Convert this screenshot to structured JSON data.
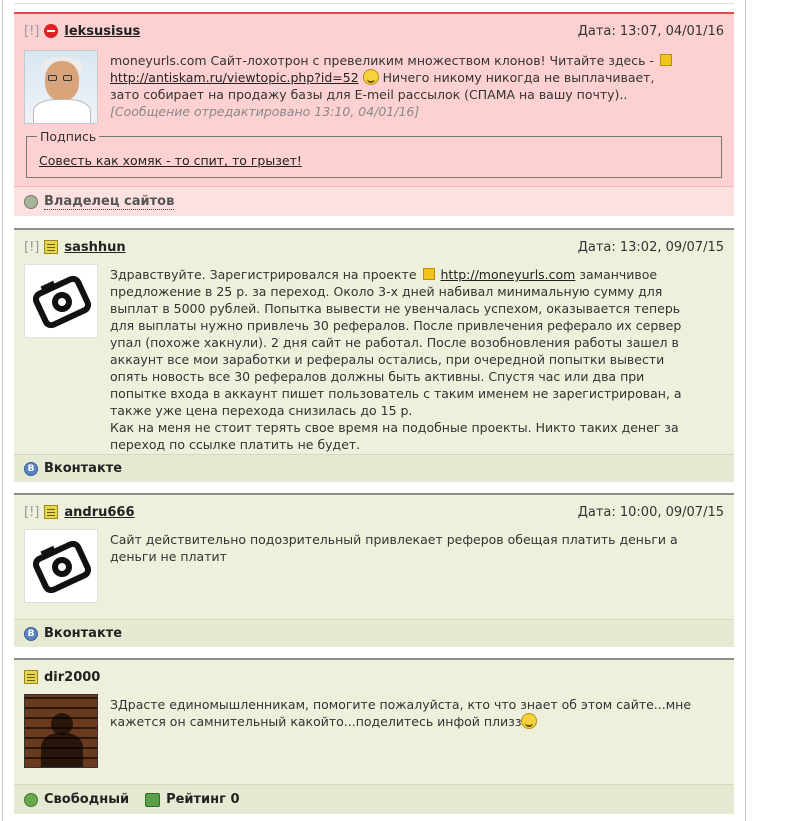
{
  "posts": [
    {
      "flag": "[!]",
      "icon": "ban-icon",
      "username": "leksusisus",
      "date": "Дата: 13:07, 04/01/16",
      "text_1": "moneyurls.com Сайт-лохотрон с превеликим множеством клонов! Читайте здесь -",
      "link": "http://antiskam.ru/viewtopic.php?id=52",
      "text_2": "Ничего никому никогда не выплачивает,",
      "text_3": "зато собирает на продажу базы для E-meil рассылок (СПАМА на вашу почту)..",
      "edited": "[Сообщение отредактировано 13:10, 04/01/16]",
      "signature_legend": "Подпись",
      "signature": "Совесть как хомяк - то спит, то грызет!",
      "footer": "Владелец сайтов"
    },
    {
      "flag": "[!]",
      "icon": "notepad-icon",
      "username": "sashhun",
      "date": "Дата: 13:02, 09/07/15",
      "text_a": "Здравствуйте. Зарегистрировался на проекте",
      "link": "http://moneyurls.com",
      "text_b": "заманчивое",
      "lines": [
        "предложение в 25 р. за переход. Около 3-х дней набивал минимальную сумму для",
        "выплат в 5000 рублей. Попытка вывести не увенчалась успехом, оказывается теперь",
        "для выплаты нужно привлечь 30 рефералов. После привлечения реферало их сервер",
        "упал (похоже хакнули). 2 дня сайт не работал. После возобновления работы зашел в",
        "аккаунт все мои заработки и рефералы остались, при очередной попытки вывести",
        "опять новость все 30 рефералов должны быть активны. Спустя час или два при",
        "попытке входа в аккаунт пишет пользователь с таким именем не зарегистрирован, а",
        "также уже цена перехода снизилась до 15 р.",
        "Как на меня не стоит терять свое время на подобные проекты. Никто таких денег за",
        "переход по ссылке платить не будет."
      ],
      "footer": "Вконтакте"
    },
    {
      "flag": "[!]",
      "icon": "notepad-icon",
      "username": "andru666",
      "date": "Дата: 10:00, 09/07/15",
      "lines": [
        "Сайт действительно подозрительный привлекает реферов обещая платить деньги а",
        "деньги не платит"
      ],
      "footer": "Вконтакте"
    },
    {
      "icon": "notepad-icon",
      "username": "dir2000",
      "line_1": "ЗДрасте единомышленникам, помогите пожалуйста, кто что знает об этом сайте...мне",
      "line_2": "кажется он самнительный какойто...поделитесь инфой плизз",
      "footer_1": "Свободный",
      "footer_2": "Рейтинг 0"
    }
  ],
  "vk_letter": "B",
  "colors": {
    "red_bg": "#fdd1d1",
    "red_border": "#e24a4a",
    "green_bg": "#eef0dc",
    "green_border": "#8d8d8d"
  }
}
